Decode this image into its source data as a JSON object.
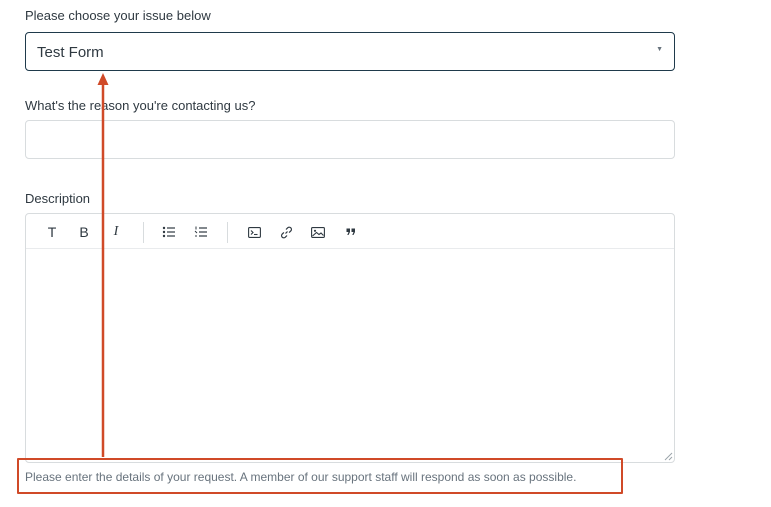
{
  "issue": {
    "label": "Please choose your issue below",
    "selected": "Test Form"
  },
  "reason": {
    "label": "What's the reason you're contacting us?",
    "value": ""
  },
  "description": {
    "label": "Description",
    "toolbar": {
      "text_format": "T",
      "bold": "B",
      "italic": "I"
    },
    "hint": "Please enter the details of your request. A member of our support staff will respond as soon as possible."
  },
  "icons": {
    "unordered_list": "bullet-list-icon",
    "ordered_list": "numbered-list-icon",
    "code": "code-block-icon",
    "link": "link-icon",
    "image": "image-icon",
    "quote": "quote-icon",
    "caret": "chevron-down-icon"
  },
  "colors": {
    "annotation": "#d04a28",
    "focus_border": "#1f3a4b",
    "border": "#d8dcde",
    "hint_text": "#68737d"
  }
}
